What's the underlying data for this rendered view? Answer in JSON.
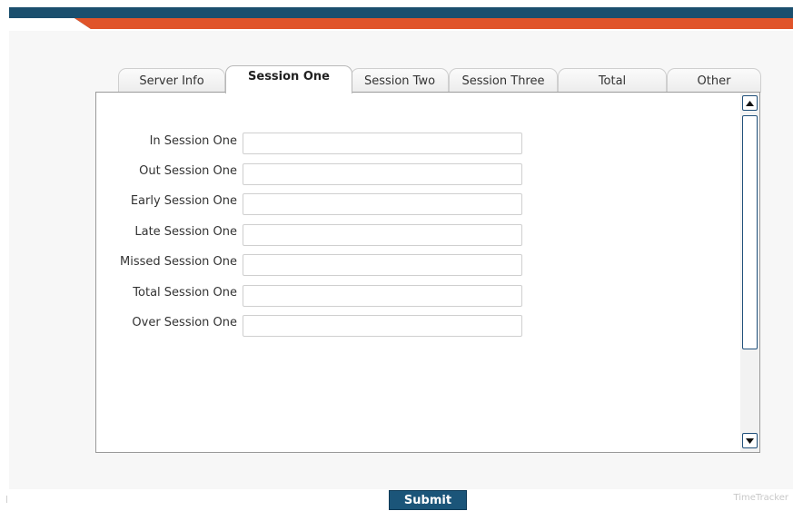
{
  "colors": {
    "header_navy": "#1b4f6e",
    "header_orange": "#e0542a",
    "accent_navy": "#1b5579",
    "panel_bg": "#f7f7f7"
  },
  "tabs": [
    {
      "label": "Server Info",
      "active": false
    },
    {
      "label": "Session One",
      "active": true
    },
    {
      "label": "Session Two",
      "active": false
    },
    {
      "label": "Session Three",
      "active": false
    },
    {
      "label": "Total",
      "active": false
    },
    {
      "label": "Other",
      "active": false
    }
  ],
  "form": {
    "fields": [
      {
        "label": "In Session One",
        "value": ""
      },
      {
        "label": "Out Session One",
        "value": ""
      },
      {
        "label": "Early Session One",
        "value": ""
      },
      {
        "label": "Late Session One",
        "value": ""
      },
      {
        "label": "Missed Session One",
        "value": ""
      },
      {
        "label": "Total Session One",
        "value": ""
      },
      {
        "label": "Over Session One",
        "value": ""
      }
    ]
  },
  "scrollbar": {
    "up_icon": "arrow-up-icon",
    "down_icon": "arrow-down-icon"
  },
  "submit_label": "Submit",
  "brand": "TimeTracker"
}
